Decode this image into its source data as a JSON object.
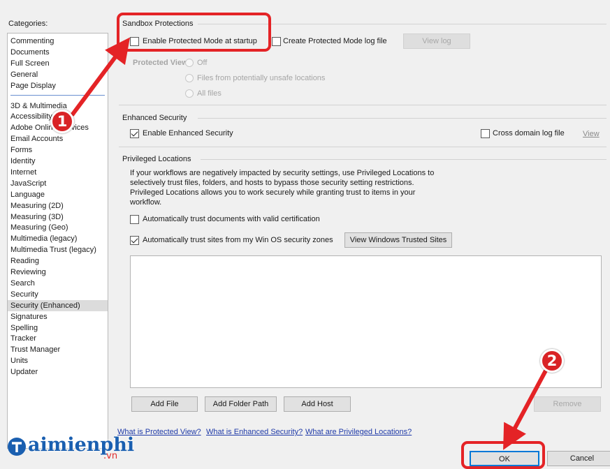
{
  "categories": {
    "label": "Categories:",
    "group1": [
      "Commenting",
      "Documents",
      "Full Screen",
      "General",
      "Page Display"
    ],
    "group2": [
      "3D & Multimedia",
      "Accessibility",
      "Adobe Online Services",
      "Email Accounts",
      "Forms",
      "Identity",
      "Internet",
      "JavaScript",
      "Language",
      "Measuring (2D)",
      "Measuring (3D)",
      "Measuring (Geo)",
      "Multimedia (legacy)",
      "Multimedia Trust (legacy)",
      "Reading",
      "Reviewing",
      "Search",
      "Security",
      "Security (Enhanced)",
      "Signatures",
      "Spelling",
      "Tracker",
      "Trust Manager",
      "Units",
      "Updater"
    ],
    "selected": "Security (Enhanced)"
  },
  "sandbox": {
    "title": "Sandbox Protections",
    "protected_mode_label": "Enable Protected Mode at startup",
    "protected_mode_checked": false,
    "log_file_label": "Create Protected Mode log file",
    "log_file_checked": false,
    "view_log_label": "View log",
    "protected_view_label": "Protected View",
    "protected_view_options": [
      "Off",
      "Files from potentially unsafe locations",
      "All files"
    ]
  },
  "enhanced": {
    "title": "Enhanced Security",
    "enable_label": "Enable Enhanced Security",
    "enable_checked": true,
    "cross_domain_label": "Cross domain log file",
    "cross_domain_checked": false,
    "view_label": "View"
  },
  "privileged": {
    "title": "Privileged Locations",
    "description": [
      "If your workflows are negatively impacted by security settings, use Privileged Locations to",
      "selectively trust files, folders, and hosts to bypass those security setting restrictions.",
      "Privileged Locations allows you to work securely while granting trust to items in your",
      "workflow."
    ],
    "auto_cert_label": "Automatically trust documents with valid certification",
    "auto_cert_checked": false,
    "auto_sites_label": "Automatically trust sites from my Win OS security zones",
    "auto_sites_checked": true,
    "view_sites_label": "View Windows Trusted Sites",
    "add_file_label": "Add File",
    "add_folder_label": "Add Folder Path",
    "add_host_label": "Add Host",
    "remove_label": "Remove"
  },
  "links": {
    "protected_view": "What is Protected View?",
    "enhanced_security": "What is Enhanced Security?",
    "privileged_locations": "What are Privileged Locations?"
  },
  "footer": {
    "ok_label": "OK",
    "cancel_label": "Cancel"
  },
  "annotations": {
    "step1": "1",
    "step2": "2",
    "highlight_color": "#e42326"
  },
  "brand": {
    "name": "aimienphi",
    "suffix": ".vn"
  }
}
